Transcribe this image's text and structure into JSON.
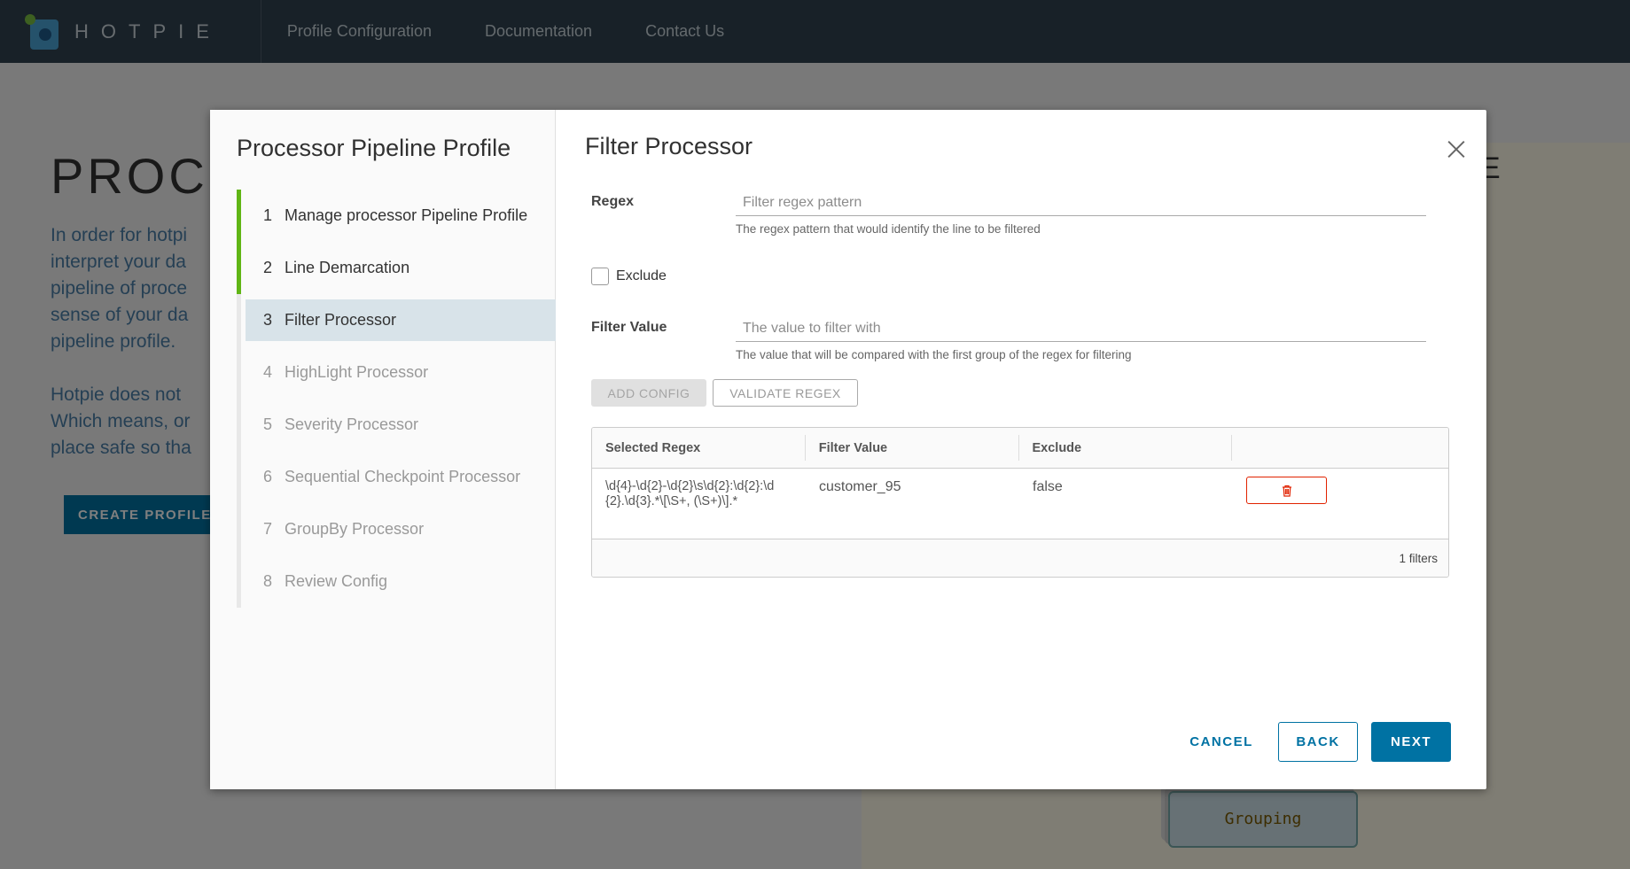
{
  "app": {
    "logo_text": "HOTPIE",
    "nav": [
      "Profile Configuration",
      "Documentation",
      "Contact Us"
    ]
  },
  "background": {
    "title": "PROC",
    "para1": [
      "In order for hotpi",
      "interpret your da",
      "pipeline of proce",
      "sense of your da",
      "pipeline profile."
    ],
    "para2": [
      "Hotpie does not",
      "Which means, or",
      "place safe so tha"
    ],
    "create_button": "CREATE PROFILE",
    "right_text": "E",
    "grouping_node": "Grouping"
  },
  "modal": {
    "sidebar_title": "Processor Pipeline Profile",
    "steps": [
      {
        "num": "1",
        "label": "Manage processor Pipeline Profile",
        "state": "done"
      },
      {
        "num": "2",
        "label": "Line Demarcation",
        "state": "done"
      },
      {
        "num": "3",
        "label": "Filter Processor",
        "state": "current"
      },
      {
        "num": "4",
        "label": "HighLight Processor",
        "state": "pending"
      },
      {
        "num": "5",
        "label": "Severity Processor",
        "state": "pending"
      },
      {
        "num": "6",
        "label": "Sequential Checkpoint Processor",
        "state": "pending"
      },
      {
        "num": "7",
        "label": "GroupBy Processor",
        "state": "pending"
      },
      {
        "num": "8",
        "label": "Review Config",
        "state": "pending"
      }
    ],
    "title": "Filter Processor",
    "regex": {
      "label": "Regex",
      "value": "",
      "placeholder": "Filter regex pattern",
      "help": "The regex pattern that would identify the line to be filtered"
    },
    "exclude": {
      "label": "Exclude",
      "checked": false
    },
    "filter_value": {
      "label": "Filter Value",
      "value": "",
      "placeholder": "The value to filter with",
      "help": "The value that will be compared with the first group of the regex for filtering"
    },
    "buttons": {
      "add_config": "ADD CONFIG",
      "validate_regex": "VALIDATE REGEX",
      "cancel": "CANCEL",
      "back": "BACK",
      "next": "NEXT"
    },
    "grid": {
      "columns": [
        "Selected Regex",
        "Filter Value",
        "Exclude",
        ""
      ],
      "rows": [
        {
          "regex": "\\d{4}-\\d{2}-\\d{2}\\s\\d{2}:\\d{2}:\\d{2}.\\d{3}.*\\[\\S+, (\\S+)\\].*",
          "filter_value": "customer_95",
          "exclude": "false"
        }
      ],
      "footer": "1 filters"
    }
  },
  "colors": {
    "primary": "#0072a3",
    "header_bg": "#314351",
    "step_done": "#60b515",
    "delete": "#e12200"
  }
}
